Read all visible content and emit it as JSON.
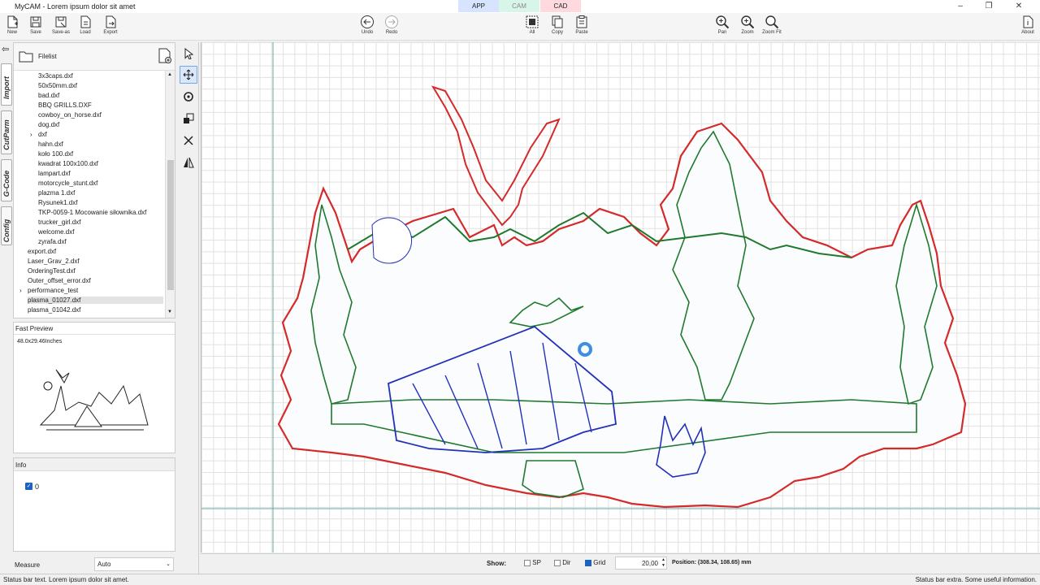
{
  "window": {
    "title": "MyCAM  - Lorem ipsum dolor sit amet",
    "controls": [
      "–",
      "❐",
      "✕"
    ]
  },
  "modes": [
    {
      "label": "APP",
      "color": "#d6e4ff"
    },
    {
      "label": "CAM",
      "color": "#d8f5ea"
    },
    {
      "label": "CAD",
      "color": "#ffd9de"
    }
  ],
  "toolbar": {
    "file": [
      {
        "label": "New",
        "icon": "new-file-icon"
      },
      {
        "label": "Save",
        "icon": "save-icon"
      },
      {
        "label": "Save-as",
        "icon": "save-as-icon"
      },
      {
        "label": "Load",
        "icon": "load-icon"
      },
      {
        "label": "Export",
        "icon": "export-icon"
      }
    ],
    "history": [
      {
        "label": "Undo",
        "icon": "undo-icon"
      },
      {
        "label": "Redo",
        "icon": "redo-icon"
      }
    ],
    "edit": [
      {
        "label": "All",
        "icon": "select-all-icon"
      },
      {
        "label": "Copy",
        "icon": "copy-icon"
      },
      {
        "label": "Paste",
        "icon": "paste-icon"
      }
    ],
    "view": [
      {
        "label": "Pan",
        "icon": "pan-zoom-icon"
      },
      {
        "label": "Zoom",
        "icon": "zoom-icon"
      },
      {
        "label": "Zoom Fit",
        "icon": "zoom-fit-icon"
      }
    ],
    "about": "About"
  },
  "side_tabs": [
    "Import",
    "CutParm",
    "G-Code",
    "Config"
  ],
  "filelist": {
    "title": "Filelist",
    "items": [
      {
        "name": "3x3caps.dxf",
        "indent": 1
      },
      {
        "name": "50x50mm.dxf",
        "indent": 1
      },
      {
        "name": "bad.dxf",
        "indent": 1
      },
      {
        "name": "BBQ GRILLS.DXF",
        "indent": 1
      },
      {
        "name": "cowboy_on_horse.dxf",
        "indent": 1
      },
      {
        "name": "dog.dxf",
        "indent": 1
      },
      {
        "name": "dxf",
        "indent": 1,
        "folder": true
      },
      {
        "name": "hahn.dxf",
        "indent": 1
      },
      {
        "name": "koło 100.dxf",
        "indent": 1
      },
      {
        "name": "kwadrat 100x100.dxf",
        "indent": 1
      },
      {
        "name": "lampart.dxf",
        "indent": 1
      },
      {
        "name": "motorcycle_stunt.dxf",
        "indent": 1
      },
      {
        "name": "plazma 1.dxf",
        "indent": 1
      },
      {
        "name": "Rysunek1.dxf",
        "indent": 1
      },
      {
        "name": "TKP-0059-1 Mocowanie siłownika.dxf",
        "indent": 1
      },
      {
        "name": "trucker_girl.dxf",
        "indent": 1
      },
      {
        "name": "welcome.dxf",
        "indent": 1
      },
      {
        "name": "zyrafa.dxf",
        "indent": 1
      },
      {
        "name": "export.dxf",
        "indent": 0
      },
      {
        "name": "Laser_Grav_2.dxf",
        "indent": 0
      },
      {
        "name": "OrderingTest.dxf",
        "indent": 0
      },
      {
        "name": "Outer_offset_error.dxf",
        "indent": 0
      },
      {
        "name": "performance_test",
        "indent": 0,
        "folder": true
      },
      {
        "name": "plasma_01027.dxf",
        "indent": 0,
        "selected": true
      },
      {
        "name": "plasma_01042.dxf",
        "indent": 0
      }
    ]
  },
  "preview": {
    "title": "Fast Preview",
    "size": "48.0x29.46Inches"
  },
  "info": {
    "title": "Info",
    "layer": "0",
    "layer_checked": true
  },
  "measure": {
    "label": "Measure",
    "value": "Auto"
  },
  "bottom": {
    "show_label": "Show:",
    "sp": {
      "label": "SP",
      "checked": false
    },
    "dir": {
      "label": "Dir",
      "checked": false
    },
    "grid": {
      "label": "Grid",
      "checked": true
    },
    "grid_size": "20,00",
    "position": "Position: (308.34, 108.65) mm"
  },
  "status": {
    "left": "Status bar text. Lorem ipsum dolor sit amet.",
    "right": "Status bar extra. Some useful information."
  },
  "colors": {
    "outer_contour": "#d42a2a",
    "inner_contour": "#1f7a2e",
    "engrave": "#2232b8",
    "cursor": "#3a8ee6",
    "accent": "#1a63c2"
  }
}
